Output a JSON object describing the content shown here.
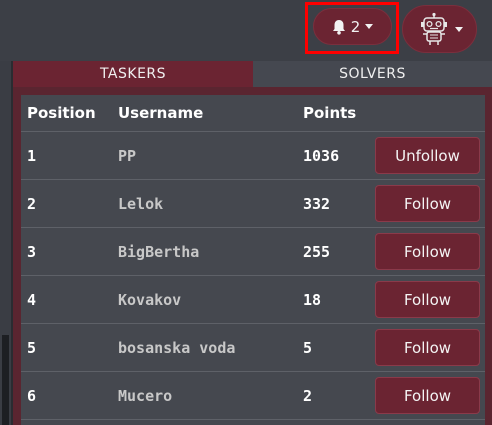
{
  "header": {
    "notification_count": "2"
  },
  "tabs": [
    {
      "label": "TASKERS",
      "active": true
    },
    {
      "label": "SOLVERS",
      "active": false
    }
  ],
  "table": {
    "columns": [
      "Position",
      "Username",
      "Points"
    ],
    "rows": [
      {
        "position": "1",
        "username": "PP",
        "points": "1036",
        "action": "Unfollow"
      },
      {
        "position": "2",
        "username": "Lelok",
        "points": "332",
        "action": "Follow"
      },
      {
        "position": "3",
        "username": "BigBertha",
        "points": "255",
        "action": "Follow"
      },
      {
        "position": "4",
        "username": "Kovakov",
        "points": "18",
        "action": "Follow"
      },
      {
        "position": "5",
        "username": "bosanska voda",
        "points": "5",
        "action": "Follow"
      },
      {
        "position": "6",
        "username": "Mucero",
        "points": "2",
        "action": "Follow"
      }
    ]
  },
  "colors": {
    "accent": "#6b2432",
    "highlight": "#ff0000",
    "background": "#3a3d44"
  },
  "icons": {
    "notifications": "bell-icon",
    "profile": "robot-avatar-icon"
  }
}
